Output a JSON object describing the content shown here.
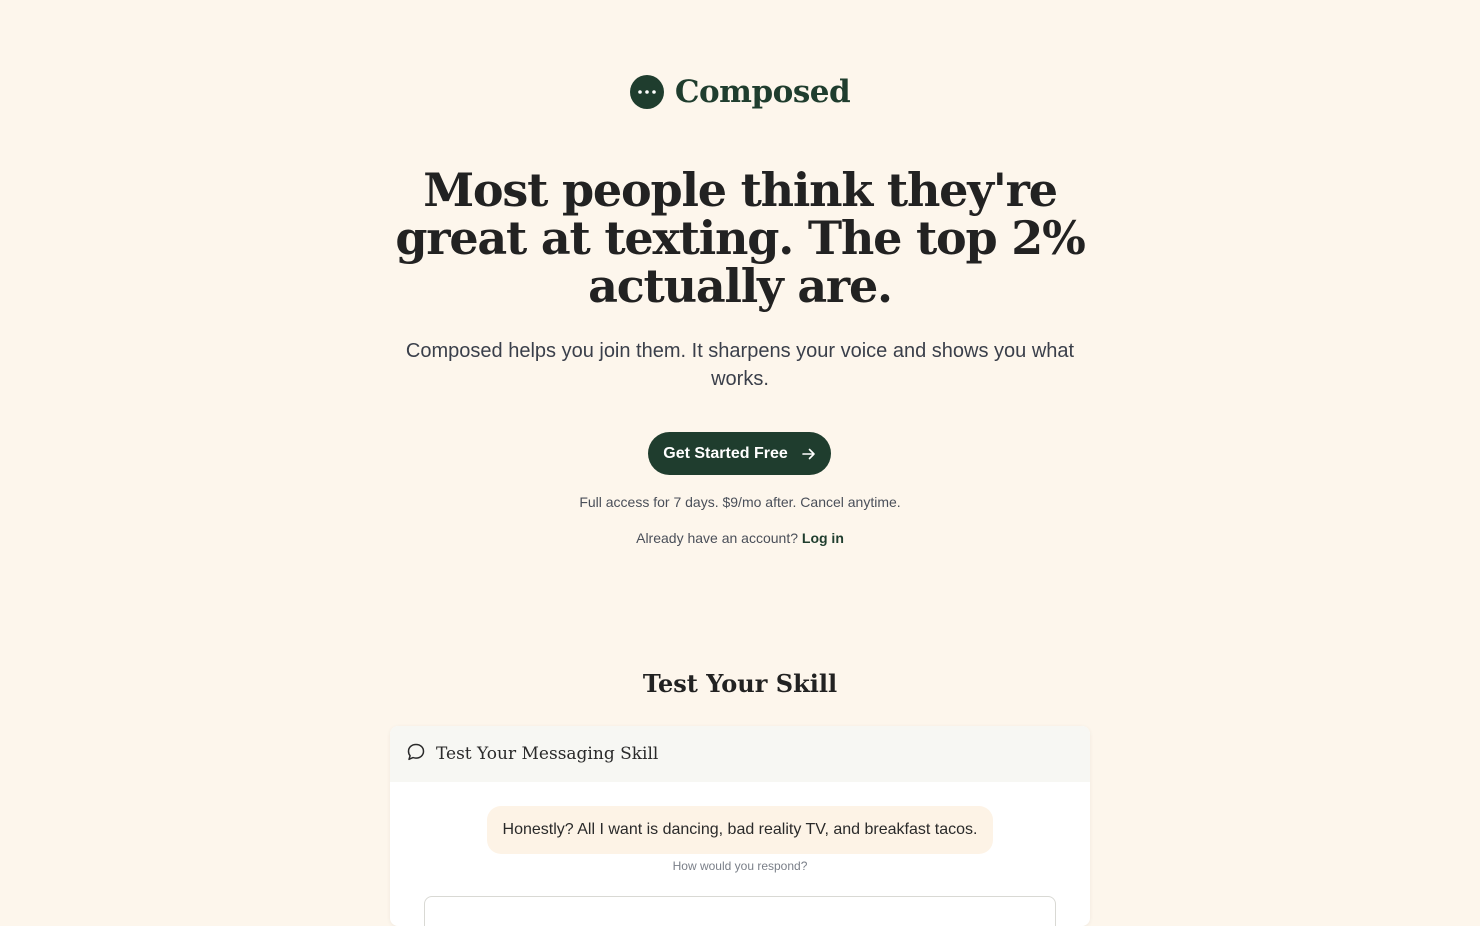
{
  "brand": {
    "name": "Composed",
    "logo_icon": "chat-dots-icon",
    "color": "#1f3d2e"
  },
  "hero": {
    "headline": "Most people think they're great at texting. The top 2% actually are.",
    "subhead": "Composed helps you join them. It sharpens your voice and shows you what works.",
    "cta_label": "Get Started Free",
    "cta_icon": "arrow-right-icon",
    "fine_print": "Full access for 7 days. $9/mo after. Cancel anytime.",
    "login_prompt": "Already have an account?",
    "login_label": "Log in"
  },
  "skill_section": {
    "title": "Test Your Skill",
    "card": {
      "header_icon": "chat-bubble-icon",
      "header_title": "Test Your Messaging Skill",
      "message": "Honestly? All I want is dancing, bad reality TV, and breakfast tacos.",
      "prompt": "How would you respond?"
    }
  },
  "colors": {
    "background": "#fdf6ec",
    "accent": "#1f3d2e",
    "bubble": "#fdf3e6",
    "card_header": "#f7f7f3"
  }
}
